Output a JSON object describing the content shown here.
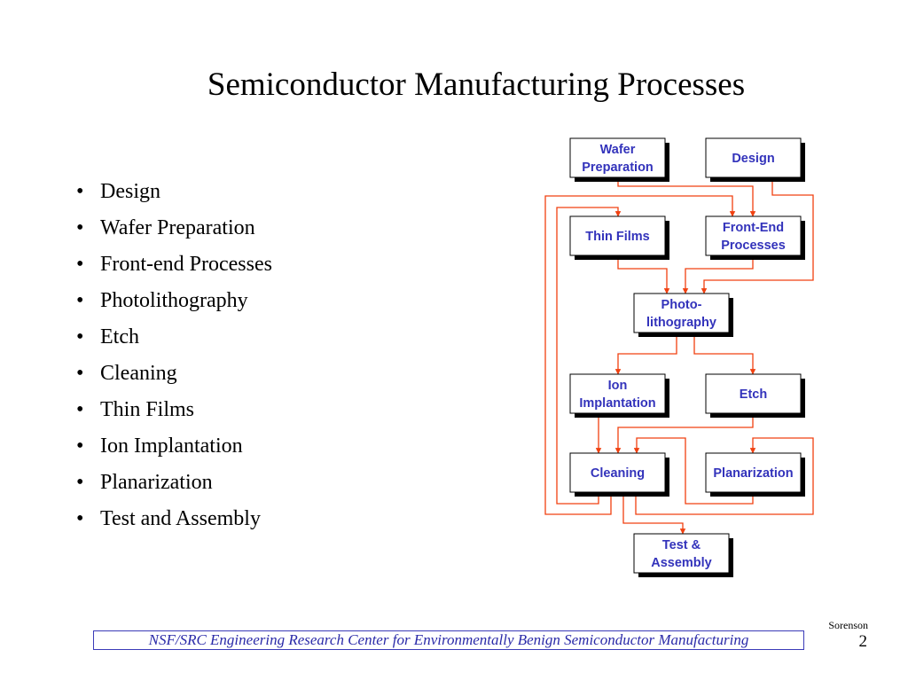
{
  "slide": {
    "title": "Semiconductor Manufacturing Processes",
    "bullets": [
      "Design",
      "Wafer Preparation",
      "Front-end Processes",
      "Photolithography",
      "Etch",
      "Cleaning",
      "Thin Films",
      "Ion Implantation",
      "Planarization",
      "Test and Assembly"
    ],
    "bullet_glyph": "•",
    "footer": "NSF/SRC Engineering Research Center for Environmentally Benign Semiconductor Manufacturing",
    "author": "Sorenson",
    "page_number": "2"
  },
  "colors": {
    "box_text": "#3333bb",
    "connector": "#f04010",
    "footer_text": "#2a2aa8"
  },
  "diagram": {
    "nodes": [
      {
        "id": "wafer-preparation",
        "lines": [
          "Wafer",
          "Preparation"
        ]
      },
      {
        "id": "design",
        "lines": [
          "Design"
        ]
      },
      {
        "id": "thin-films",
        "lines": [
          "Thin Films"
        ]
      },
      {
        "id": "front-end-processes",
        "lines": [
          "Front-End",
          "Processes"
        ]
      },
      {
        "id": "photolithography",
        "lines": [
          "Photo-",
          "lithography"
        ]
      },
      {
        "id": "ion-implantation",
        "lines": [
          "Ion",
          "Implantation"
        ]
      },
      {
        "id": "etch",
        "lines": [
          "Etch"
        ]
      },
      {
        "id": "cleaning",
        "lines": [
          "Cleaning"
        ]
      },
      {
        "id": "planarization",
        "lines": [
          "Planarization"
        ]
      },
      {
        "id": "test-assembly",
        "lines": [
          "Test &",
          "Assembly"
        ]
      }
    ],
    "edges": [
      {
        "from": "wafer-preparation",
        "to": "front-end-processes"
      },
      {
        "from": "design",
        "to": "photolithography"
      },
      {
        "from": "thin-films",
        "to": "photolithography"
      },
      {
        "from": "front-end-processes",
        "to": "photolithography"
      },
      {
        "from": "photolithography",
        "to": "ion-implantation"
      },
      {
        "from": "photolithography",
        "to": "etch"
      },
      {
        "from": "ion-implantation",
        "to": "cleaning"
      },
      {
        "from": "etch",
        "to": "cleaning"
      },
      {
        "from": "planarization",
        "to": "cleaning"
      },
      {
        "from": "cleaning",
        "to": "thin-films"
      },
      {
        "from": "cleaning",
        "to": "front-end-processes"
      },
      {
        "from": "cleaning",
        "to": "planarization"
      },
      {
        "from": "cleaning",
        "to": "test-assembly"
      }
    ]
  }
}
